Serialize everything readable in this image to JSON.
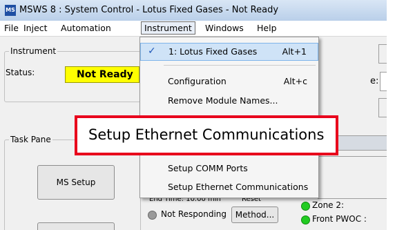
{
  "window": {
    "title": "MSWS 8 : System Control - Lotus Fixed Gases - Not Ready",
    "icon_label": "MS"
  },
  "menubar": {
    "items": [
      "File",
      "Inject",
      "Automation",
      "Instrument",
      "Windows",
      "Help"
    ]
  },
  "instrument_panel": {
    "group_label": "Instrument",
    "status_label": "Status:",
    "status_value": "Not Ready",
    "status_color": "#ffff00"
  },
  "task_pane": {
    "group_label": "Task Pane",
    "ms_setup_label": "MS Setup"
  },
  "instrument_menu": {
    "items": [
      {
        "label": "1: Lotus Fixed Gases",
        "shortcut": "Alt+1",
        "checked": true
      },
      {
        "label": "Configuration",
        "shortcut": "Alt+c"
      },
      {
        "label": "Remove Module Names..."
      },
      {
        "label": "Setup COMM Ports"
      },
      {
        "label": "Setup Ethernet Communications"
      }
    ]
  },
  "callout": {
    "text": "Setup Ethernet Communications",
    "border_color": "#e8001c"
  },
  "background": {
    "end_time_text": "End Time:   10.00 min",
    "reset_label": "Reset",
    "not_responding_label": "Not Responding",
    "method_button_label": "Method...",
    "zone2_label": "Zone 2:",
    "front_pwoc_label": "Front PWOC :",
    "partial_label": "e:"
  }
}
